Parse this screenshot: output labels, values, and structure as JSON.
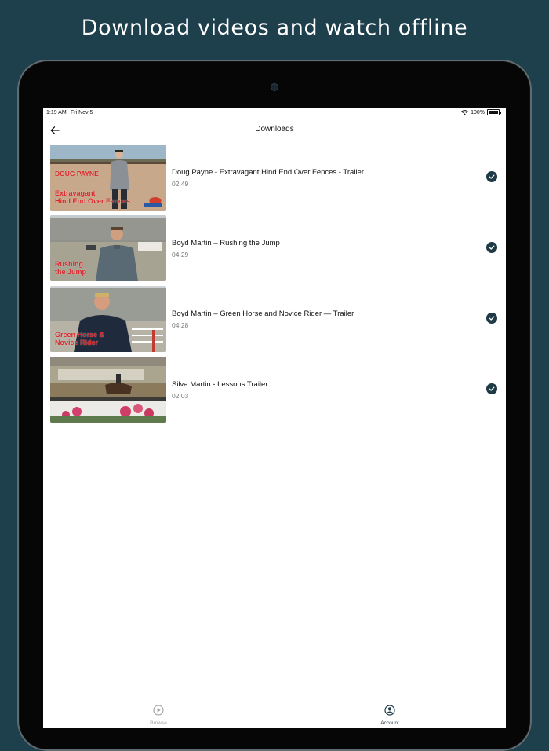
{
  "headline": "Download videos and watch offline",
  "status_bar": {
    "time": "1:19 AM",
    "date": "Fri Nov 5",
    "battery": "100%"
  },
  "nav": {
    "title": "Downloads"
  },
  "downloads": [
    {
      "title": "Doug Payne - Extravagant Hind End Over Fences - Trailer",
      "duration": "02:49",
      "downloaded": true,
      "thumb_overlay": [
        "DOUG PAYNE",
        "Extravagant",
        "Hind End Over Fences"
      ]
    },
    {
      "title": "Boyd Martin – Rushing the Jump",
      "duration": "04:29",
      "downloaded": true,
      "thumb_overlay": [
        "Rushing",
        "the Jump"
      ]
    },
    {
      "title": "Boyd Martin – Green Horse and Novice Rider — Trailer",
      "duration": "04:28",
      "downloaded": true,
      "thumb_overlay": [
        "Green Horse &",
        "Novice Rider"
      ]
    },
    {
      "title": "Silva Martin - Lessons Trailer",
      "duration": "02:03",
      "downloaded": true,
      "thumb_overlay": []
    }
  ],
  "tabbar": {
    "browse_label": "Browse",
    "account_label": "Account",
    "active": "Account"
  },
  "colors": {
    "background": "#1e3f4c",
    "accent": "#1f3a47",
    "overlay_text": "#d8262b"
  }
}
